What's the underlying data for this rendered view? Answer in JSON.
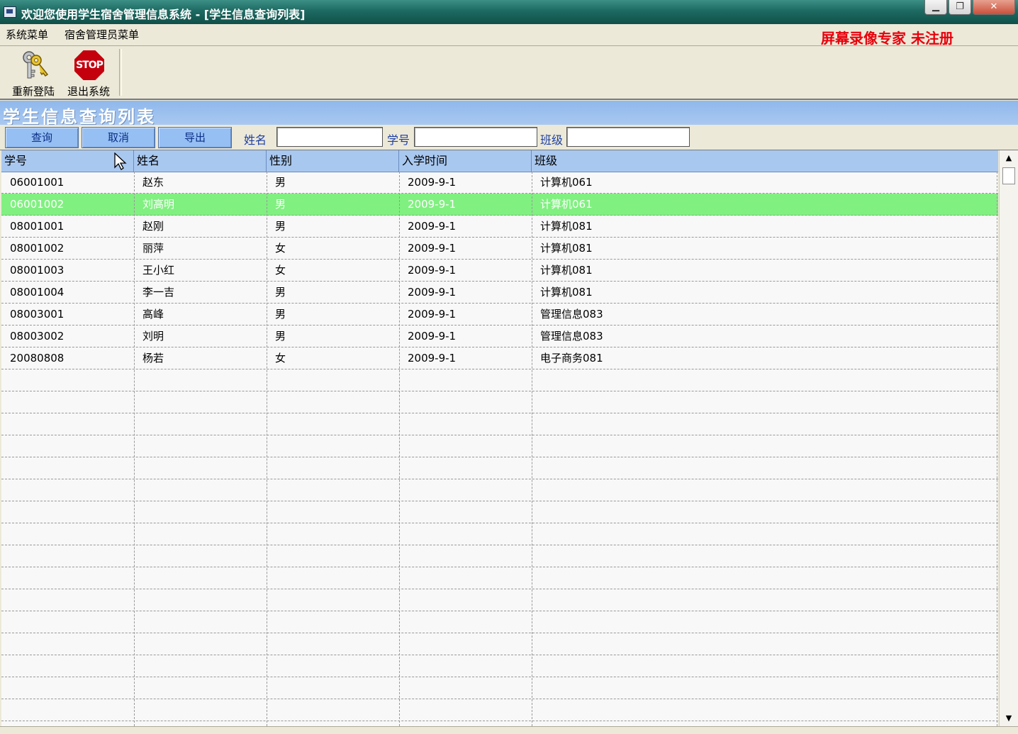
{
  "window": {
    "title": "欢迎您使用学生宿舍管理信息系统 - [学生信息查询列表]"
  },
  "menu": {
    "items": [
      "系统菜单",
      "宿舍管理员菜单"
    ]
  },
  "watermark": "屏幕录像专家  未注册",
  "toolbar": {
    "relogin_label": "重新登陆",
    "exit_label": "退出系统",
    "stop_text": "STOP"
  },
  "form": {
    "title": "学生信息查询列表"
  },
  "search": {
    "query_label": "查询",
    "cancel_label": "取消",
    "export_label": "导出",
    "name_label": "姓名",
    "name_value": "",
    "id_label": "学号",
    "id_value": "",
    "class_label": "班级",
    "class_value": ""
  },
  "table": {
    "columns": [
      "学号",
      "姓名",
      "性别",
      "入学时间",
      "班级"
    ],
    "selected_row": 1,
    "rows": [
      [
        "06001001",
        "赵东",
        "男",
        "2009-9-1",
        "计算机061"
      ],
      [
        "06001002",
        "刘高明",
        "男",
        "2009-9-1",
        "计算机061"
      ],
      [
        "08001001",
        "赵刚",
        "男",
        "2009-9-1",
        "计算机081"
      ],
      [
        "08001002",
        "丽萍",
        "女",
        "2009-9-1",
        "计算机081"
      ],
      [
        "08001003",
        "王小红",
        "女",
        "2009-9-1",
        "计算机081"
      ],
      [
        "08001004",
        "李一吉",
        "男",
        "2009-9-1",
        "计算机081"
      ],
      [
        "08003001",
        "高峰",
        "男",
        "2009-9-1",
        "管理信息083"
      ],
      [
        "08003002",
        "刘明",
        "男",
        "2009-9-1",
        "管理信息083"
      ],
      [
        "20080808",
        "杨若",
        "女",
        "2009-9-1",
        "电子商务081"
      ]
    ]
  },
  "colors": {
    "selected_row": "#80f080",
    "header": "#a9c8f0",
    "watermark": "#e8000c"
  }
}
